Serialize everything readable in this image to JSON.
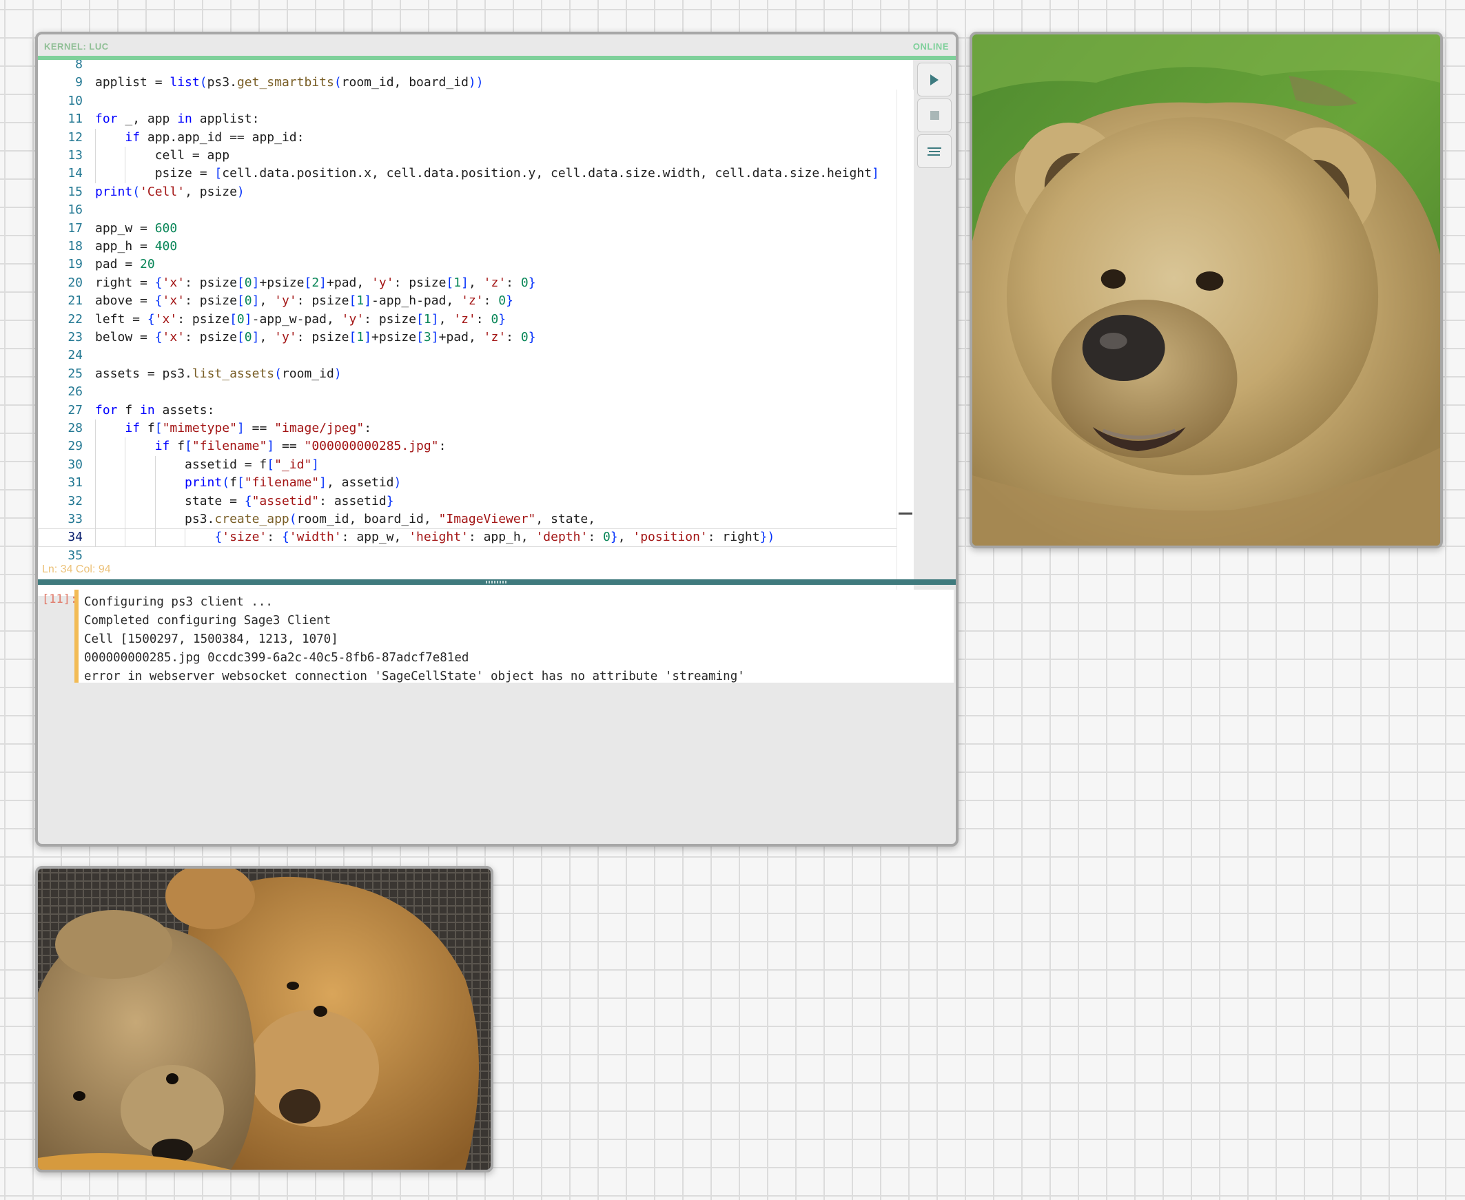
{
  "cell": {
    "kernel_label": "KERNEL: LUC",
    "status": "ONLINE",
    "cursor_position": "Ln: 34 Col: 94",
    "execution_count": "[11]:",
    "colors": {
      "status": "#7ed09a",
      "accent": "#3f7a7d",
      "output_bar": "#f2bb55"
    },
    "buttons": [
      {
        "name": "run-button",
        "icon": "play-icon"
      },
      {
        "name": "stop-button",
        "icon": "stop-icon"
      },
      {
        "name": "format-button",
        "icon": "format-lines-icon"
      }
    ],
    "active_line": 34,
    "code": [
      {
        "n": "8",
        "t": ""
      },
      {
        "n": "9",
        "t": "applist = list(ps3.get_smartbits(room_id, board_id))"
      },
      {
        "n": "10",
        "t": ""
      },
      {
        "n": "11",
        "t": "for _, app in applist:"
      },
      {
        "n": "12",
        "t": "    if app.app_id == app_id:"
      },
      {
        "n": "13",
        "t": "        cell = app"
      },
      {
        "n": "14",
        "t": "        psize = [cell.data.position.x, cell.data.position.y, cell.data.size.width, cell.data.size.height]"
      },
      {
        "n": "15",
        "t": "print('Cell', psize)"
      },
      {
        "n": "16",
        "t": ""
      },
      {
        "n": "17",
        "t": "app_w = 600"
      },
      {
        "n": "18",
        "t": "app_h = 400"
      },
      {
        "n": "19",
        "t": "pad = 20"
      },
      {
        "n": "20",
        "t": "right = {'x': psize[0]+psize[2]+pad, 'y': psize[1], 'z': 0}"
      },
      {
        "n": "21",
        "t": "above = {'x': psize[0], 'y': psize[1]-app_h-pad, 'z': 0}"
      },
      {
        "n": "22",
        "t": "left = {'x': psize[0]-app_w-pad, 'y': psize[1], 'z': 0}"
      },
      {
        "n": "23",
        "t": "below = {'x': psize[0], 'y': psize[1]+psize[3]+pad, 'z': 0}"
      },
      {
        "n": "24",
        "t": ""
      },
      {
        "n": "25",
        "t": "assets = ps3.list_assets(room_id)"
      },
      {
        "n": "26",
        "t": ""
      },
      {
        "n": "27",
        "t": "for f in assets:"
      },
      {
        "n": "28",
        "t": "    if f[\"mimetype\"] == \"image/jpeg\":"
      },
      {
        "n": "29",
        "t": "        if f[\"filename\"] == \"000000000285.jpg\":"
      },
      {
        "n": "30",
        "t": "            assetid = f[\"_id\"]"
      },
      {
        "n": "31",
        "t": "            print(f[\"filename\"], assetid)"
      },
      {
        "n": "32",
        "t": "            state = {\"assetid\": assetid}"
      },
      {
        "n": "33",
        "t": "            ps3.create_app(room_id, board_id, \"ImageViewer\", state,"
      },
      {
        "n": "34",
        "t": "                {'size': {'width': app_w, 'height': app_h, 'depth': 0}, 'position': right})"
      },
      {
        "n": "35",
        "t": ""
      }
    ],
    "output": [
      "Configuring ps3 client ...",
      "Completed configuring Sage3 Client",
      "Cell [1500297, 1500384, 1213, 1070]",
      "000000000285.jpg 0ccdc399-6a2c-40c5-8fb6-87adcf7e81ed",
      "error in webserver websocket connection 'SageCellState' object has no attribute 'streaming'"
    ]
  },
  "images": [
    {
      "name": "bear-image-viewer",
      "subject": "brown-bear-photo"
    },
    {
      "name": "teddy-bears-image-viewer",
      "subject": "teddy-bears-photo"
    }
  ]
}
